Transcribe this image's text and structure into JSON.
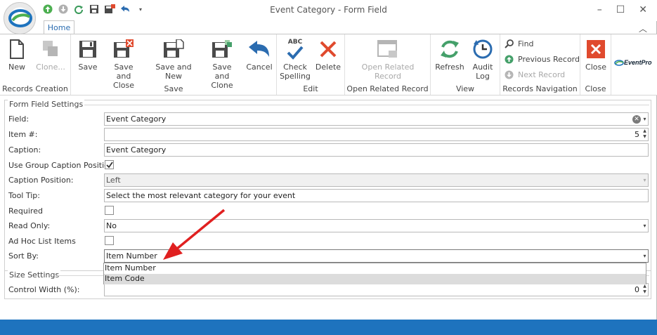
{
  "window": {
    "title": "Event Category - Form Field"
  },
  "tabs": {
    "home": "Home"
  },
  "ribbon": {
    "records_creation": {
      "label": "Records Creation",
      "new": "New",
      "clone": "Clone..."
    },
    "save": {
      "label": "Save",
      "save": "Save",
      "save_close_1": "Save and",
      "save_close_2": "Close",
      "save_new": "Save and New",
      "save_clone_1": "Save and",
      "save_clone_2": "Clone",
      "cancel": "Cancel"
    },
    "edit": {
      "label": "Edit",
      "check_1": "Check",
      "check_2": "Spelling",
      "delete": "Delete",
      "abc": "ABC"
    },
    "related": {
      "label": "Open Related Record",
      "btn_1": "Open Related",
      "btn_2": "Record"
    },
    "view": {
      "label": "View",
      "refresh": "Refresh",
      "audit_1": "Audit",
      "audit_2": "Log"
    },
    "nav": {
      "label": "Records Navigation",
      "find": "Find",
      "previous": "Previous Record",
      "next": "Next Record"
    },
    "close": {
      "label": "Close",
      "close": "Close"
    },
    "brand": "EventPro"
  },
  "form": {
    "section_title": "Form Field Settings",
    "field": {
      "label": "Field:",
      "value": "Event Category"
    },
    "item_no": {
      "label": "Item #:",
      "value": "5"
    },
    "caption": {
      "label": "Caption:",
      "value": "Event Category"
    },
    "use_group_caption": {
      "label": "Use Group Caption Position",
      "checked": true
    },
    "caption_position": {
      "label": "Caption Position:",
      "value": "Left"
    },
    "tool_tip": {
      "label": "Tool Tip:",
      "value": "Select the most relevant category for your event"
    },
    "required": {
      "label": "Required",
      "checked": false
    },
    "read_only": {
      "label": "Read Only:",
      "value": "No"
    },
    "ad_hoc": {
      "label": "Ad Hoc List Items",
      "checked": false
    },
    "sort_by": {
      "label": "Sort By:",
      "value": "Item Number",
      "options": [
        "Item Number",
        "Item Code"
      ]
    }
  },
  "size": {
    "section_title": "Size Settings",
    "control_width": {
      "label": "Control Width (%):",
      "value": "0"
    }
  },
  "colors": {
    "accent": "#1e73be",
    "red": "#e04a2e",
    "green": "#45a06a"
  }
}
